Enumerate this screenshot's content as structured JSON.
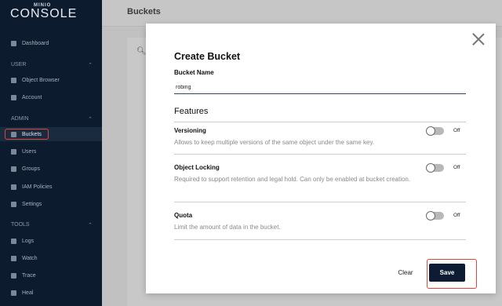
{
  "sidebar": {
    "logo_brand": "MINIO",
    "logo_name": "CONSOLE",
    "dashboard": "Dashboard",
    "sections": [
      {
        "label": "USER"
      },
      {
        "label": "ADMIN"
      },
      {
        "label": "TOOLS"
      }
    ],
    "user_items": [
      "Object Browser",
      "Account"
    ],
    "admin_items": [
      "Buckets",
      "Users",
      "Groups",
      "IAM Policies",
      "Settings"
    ],
    "tools_items": [
      "Logs",
      "Watch",
      "Trace",
      "Heal"
    ]
  },
  "header": {
    "title": "Buckets"
  },
  "modal": {
    "title": "Create Bucket",
    "bucket_name_label": "Bucket Name",
    "bucket_name_value": "robing",
    "features_title": "Features",
    "options": [
      {
        "title": "Versioning",
        "description": "Allows to keep multiple versions of the same object under the same key.",
        "state": "Off"
      },
      {
        "title": "Object Locking",
        "description": "Required to support retention and legal hold. Can only be enabled at bucket creation.",
        "state": "Off"
      },
      {
        "title": "Quota",
        "description": "Limit the amount of data in the bucket.",
        "state": "Off"
      }
    ],
    "clear_label": "Clear",
    "save_label": "Save"
  },
  "colors": {
    "sidebar_bg": "#0c1b2e",
    "save_bg": "#0d1b33",
    "highlight": "#e0443b"
  }
}
